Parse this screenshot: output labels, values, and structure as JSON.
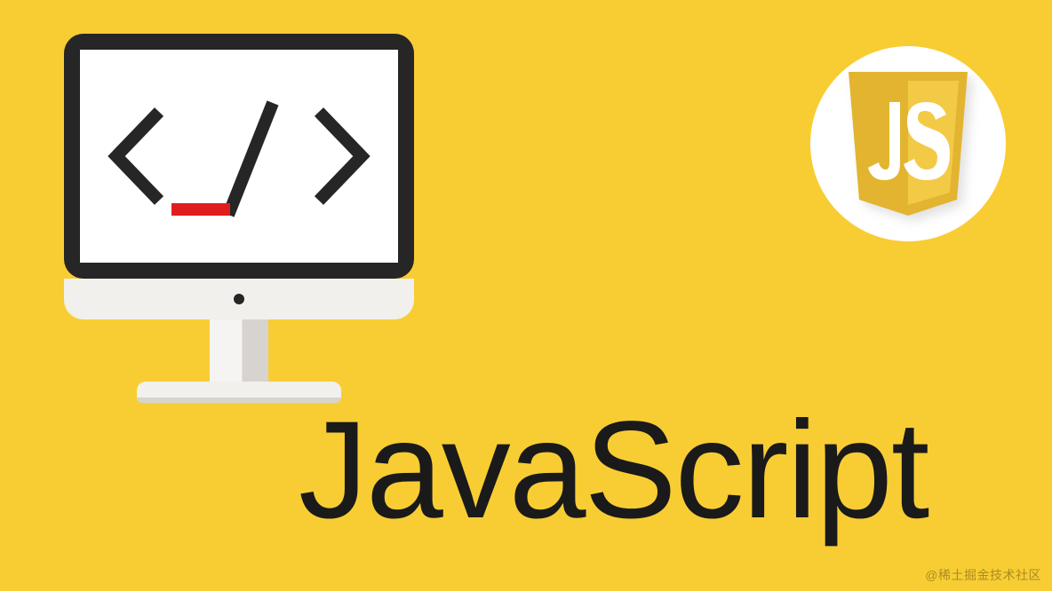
{
  "title": "JavaScript",
  "badge": {
    "text": "JS"
  },
  "watermark": "@稀土掘金技术社区",
  "monitor_glyph": {
    "left": "<",
    "underscore": "_",
    "slash": "/",
    "right": ">"
  },
  "colors": {
    "background": "#f8cd33",
    "bezel": "#262626",
    "accent_red": "#e01d1d",
    "shield_outer": "#e2b430",
    "shield_inner": "#f3ca46"
  }
}
